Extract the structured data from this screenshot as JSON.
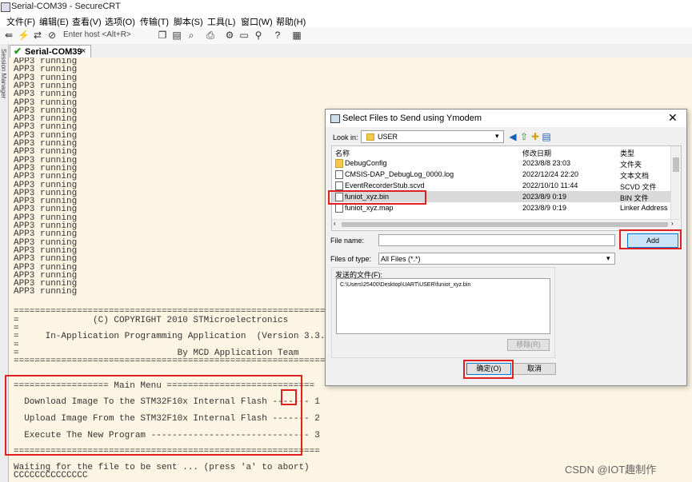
{
  "window": {
    "title": "Serial-COM39 - SecureCRT"
  },
  "menu": [
    "文件(F)",
    "编辑(E)",
    "查看(V)",
    "选项(O)",
    "传输(T)",
    "脚本(S)",
    "工具(L)",
    "窗口(W)",
    "帮助(H)"
  ],
  "toolbar": {
    "host_placeholder": "Enter host <Alt+R>"
  },
  "tab": {
    "label": "Serial-COM39",
    "close": "×"
  },
  "sidebar": {
    "label": "Session Manager"
  },
  "terminal": {
    "running_line": "APP3 running",
    "running_count": 29,
    "banner": [
      "================================================================",
      "=              (C) COPYRIGHT 2010 STMicroelectronics",
      "=",
      "=     In-Application Programming Application  (Version 3.3.0)",
      "=",
      "=                              By MCD Application Team",
      "================================================================"
    ],
    "menu_header": "================== Main Menu ============================",
    "menu_items": [
      "  Download Image To the STM32F10x Internal Flash ------- 1",
      "  Upload Image From the STM32F10x Internal Flash ------- 2",
      "  Execute The New Program ------------------------------ 3"
    ],
    "menu_footer": "==========================================================",
    "waiting": "Waiting for the file to be sent ... (press 'a' to abort)",
    "ccc": "CCCCCCCCCCCCCC"
  },
  "dialog": {
    "title": "Select Files to Send using Ymodem",
    "close": "✕",
    "look_in_label": "Look in:",
    "look_in_value": "USER",
    "columns": [
      "名称",
      "修改日期",
      "类型"
    ],
    "files": [
      {
        "name": "DebugConfig",
        "date": "2023/8/8 23:03",
        "type": "文件夹",
        "icon": "folder-icon"
      },
      {
        "name": "CMSIS-DAP_DebugLog_0000.log",
        "date": "2022/12/24 22:20",
        "type": "文本文档",
        "icon": "document-icon"
      },
      {
        "name": "EventRecorderStub.scvd",
        "date": "2022/10/10 11:44",
        "type": "SCVD 文件",
        "icon": "document-icon"
      },
      {
        "name": "funiot_xyz.bin",
        "date": "2023/8/9 0:19",
        "type": "BIN 文件",
        "icon": "document-icon",
        "selected": true
      },
      {
        "name": "funiot_xyz.map",
        "date": "2023/8/9 0:19",
        "type": "Linker Address",
        "icon": "document-icon"
      }
    ],
    "file_name_label": "File name:",
    "file_name_value": "",
    "add_label": "Add",
    "files_of_type_label": "Files of type:",
    "files_of_type_value": "All Files (*.*)",
    "send_list_label": "发送的文件(F):",
    "send_list": [
      "C:\\Users\\25400\\Desktop\\UART\\USER\\funiot_xyz.bin"
    ],
    "remove_label": "移除(R)",
    "ok_label": "确定(O)",
    "cancel_label": "取消"
  },
  "watermark": "CSDN @IOT趣制作",
  "colors": {
    "terminal_bg": "#fcf5e3",
    "highlight": "#e02020",
    "selection": "#d9d9d9"
  }
}
